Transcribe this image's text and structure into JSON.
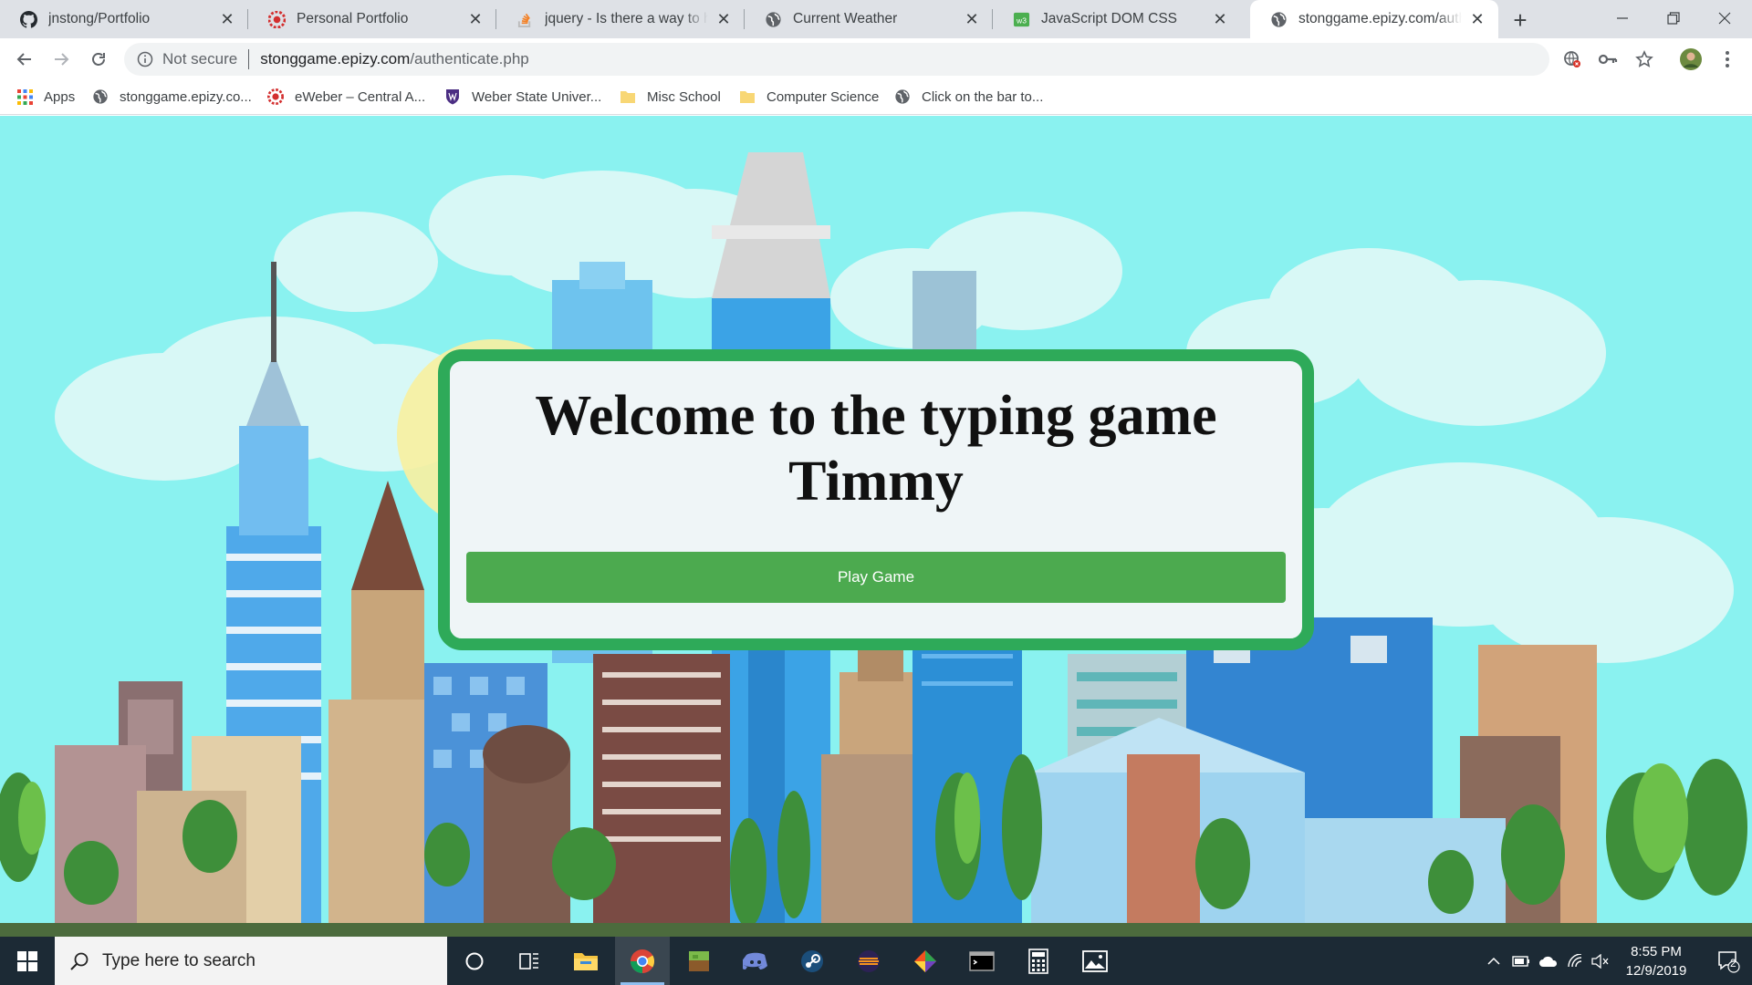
{
  "tabs": [
    {
      "title": "jnstong/Portfolio",
      "icon": "github-icon"
    },
    {
      "title": "Personal Portfolio",
      "icon": "weber-icon"
    },
    {
      "title": "jquery - Is there a way to hide",
      "icon": "stackoverflow-icon"
    },
    {
      "title": "Current Weather",
      "icon": "globe-icon"
    },
    {
      "title": "JavaScript DOM CSS",
      "icon": "w3schools-icon"
    },
    {
      "title": "stonggame.epizy.com/authenticate.php",
      "icon": "globe-icon"
    }
  ],
  "active_tab": 5,
  "address_bar": {
    "security_label": "Not secure",
    "host": "stonggame.epizy.com",
    "path": "/authenticate.php"
  },
  "bookmarks": [
    {
      "label": "Apps",
      "icon": "apps-grid-icon"
    },
    {
      "label": "stonggame.epizy.co...",
      "icon": "globe-icon"
    },
    {
      "label": "eWeber – Central A...",
      "icon": "weber-icon"
    },
    {
      "label": "Weber State Univer...",
      "icon": "shield-icon"
    },
    {
      "label": "Misc School",
      "icon": "folder-icon"
    },
    {
      "label": "Computer Science",
      "icon": "folder-icon"
    },
    {
      "label": "Click on the bar to...",
      "icon": "globe-icon"
    }
  ],
  "page": {
    "heading_line1": "Welcome to the typing game",
    "heading_line2": "Timmy",
    "play_button": "Play Game"
  },
  "taskbar": {
    "search_placeholder": "Type here to search",
    "time": "8:55 PM",
    "date": "12/9/2019",
    "notification_count": "2"
  },
  "colors": {
    "sky": "#8af2f0",
    "card_border": "#2eaa59",
    "button": "#4caa4f",
    "taskbar": "#1c2a35"
  }
}
